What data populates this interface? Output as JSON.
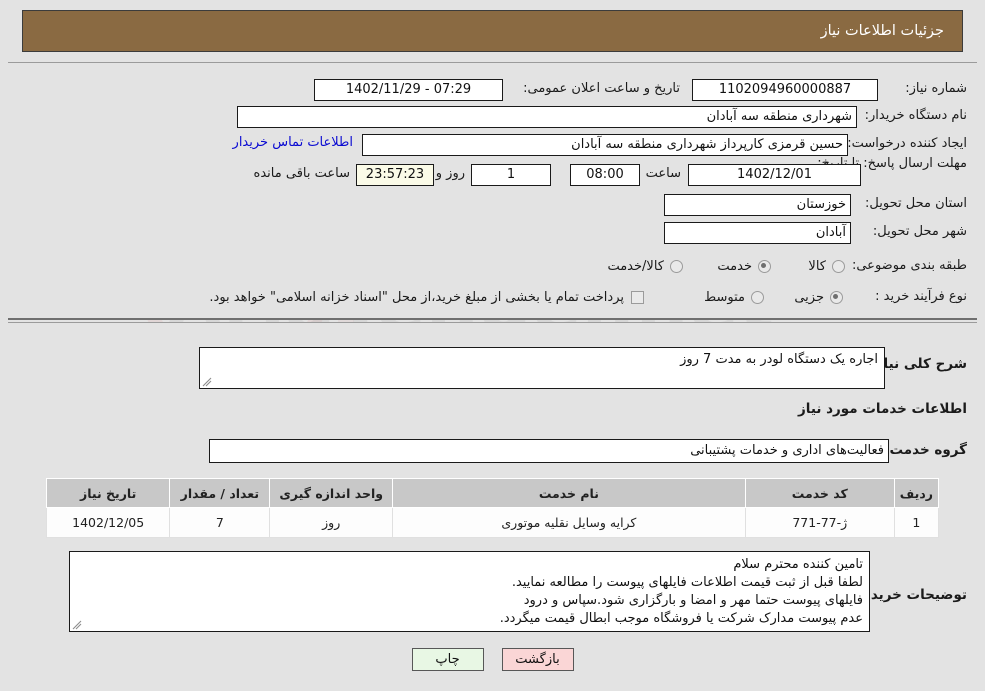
{
  "header": {
    "title": "جزئیات اطلاعات نیاز"
  },
  "form": {
    "need_number_label": "شماره نیاز:",
    "need_number_value": "1102094960000887",
    "announce_label": "تاریخ و ساعت اعلان عمومی:",
    "announce_value": "07:29 - 1402/11/29",
    "buyer_org_label": "نام دستگاه خریدار:",
    "buyer_org_value": "شهرداری منطقه سه آبادان",
    "creator_label": "ایجاد کننده درخواست:",
    "creator_value": "حسین قرمزی کارپرداز شهرداری منطقه سه آبادان",
    "contact_link": "اطلاعات تماس خریدار",
    "deadline_label": "مهلت ارسال پاسخ: تا تاریخ:",
    "deadline_date": "1402/12/01",
    "hour_label": "ساعت",
    "deadline_time": "08:00",
    "days_value": "1",
    "days_label": "روز و",
    "countdown_value": "23:57:23",
    "countdown_label": "ساعت باقی مانده",
    "province_label": "استان محل تحویل:",
    "province_value": "خوزستان",
    "city_label": "شهر محل تحویل:",
    "city_value": "آبادان",
    "category_label": "طبقه بندی موضوعی:",
    "category_options": [
      "کالا",
      "خدمت",
      "کالا/خدمت"
    ],
    "category_selected": "خدمت",
    "process_label": "نوع فرآیند خرید :",
    "process_options": [
      "جزیی",
      "متوسط"
    ],
    "process_selected": "جزیی",
    "treasury_note": "پرداخت تمام یا بخشی از مبلغ خرید،از محل \"اسناد خزانه اسلامی\" خواهد بود.",
    "treasury_checked": false
  },
  "summary": {
    "label": "شرح کلی نیاز:",
    "value": "اجاره یک دستگاه لودر به مدت 7 روز"
  },
  "services": {
    "section_title": "اطلاعات خدمات مورد نیاز",
    "group_label": "گروه خدمت:",
    "group_value": "فعالیت‌های اداری و خدمات پشتیبانی",
    "columns": [
      "ردیف",
      "کد خدمت",
      "نام خدمت",
      "واحد اندازه گیری",
      "تعداد / مقدار",
      "تاریخ نیاز"
    ],
    "rows": [
      {
        "row_no": "1",
        "service_code": "ژ-77-771",
        "service_name": "کرایه وسایل نقلیه موتوری",
        "unit": "روز",
        "quantity": "7",
        "need_date": "1402/12/05"
      }
    ]
  },
  "buyer_notes": {
    "label": "توضیحات خریدار:",
    "lines": [
      "تامین کننده محترم سلام",
      "لطفا قبل از ثبت قیمت اطلاعات فایلهای پیوست را مطالعه نمایید.",
      "فایلهای پیوست حتما مهر و امضا و بارگزاری شود.سپاس و درود",
      "عدم پیوست مدارک شرکت یا فروشگاه موجب ابطال قیمت میگردد."
    ]
  },
  "footer": {
    "print_label": "چاپ",
    "back_label": "بازگشت"
  },
  "colors": {
    "header_bar": "#8a6a42",
    "page_bg": "#e3e3e3",
    "link": "#0a0ad2",
    "back_btn": "#fad6d6",
    "print_btn": "#e8f7e4",
    "timer_bg": "#fbfbe8",
    "table_header": "#c8c8c8"
  }
}
